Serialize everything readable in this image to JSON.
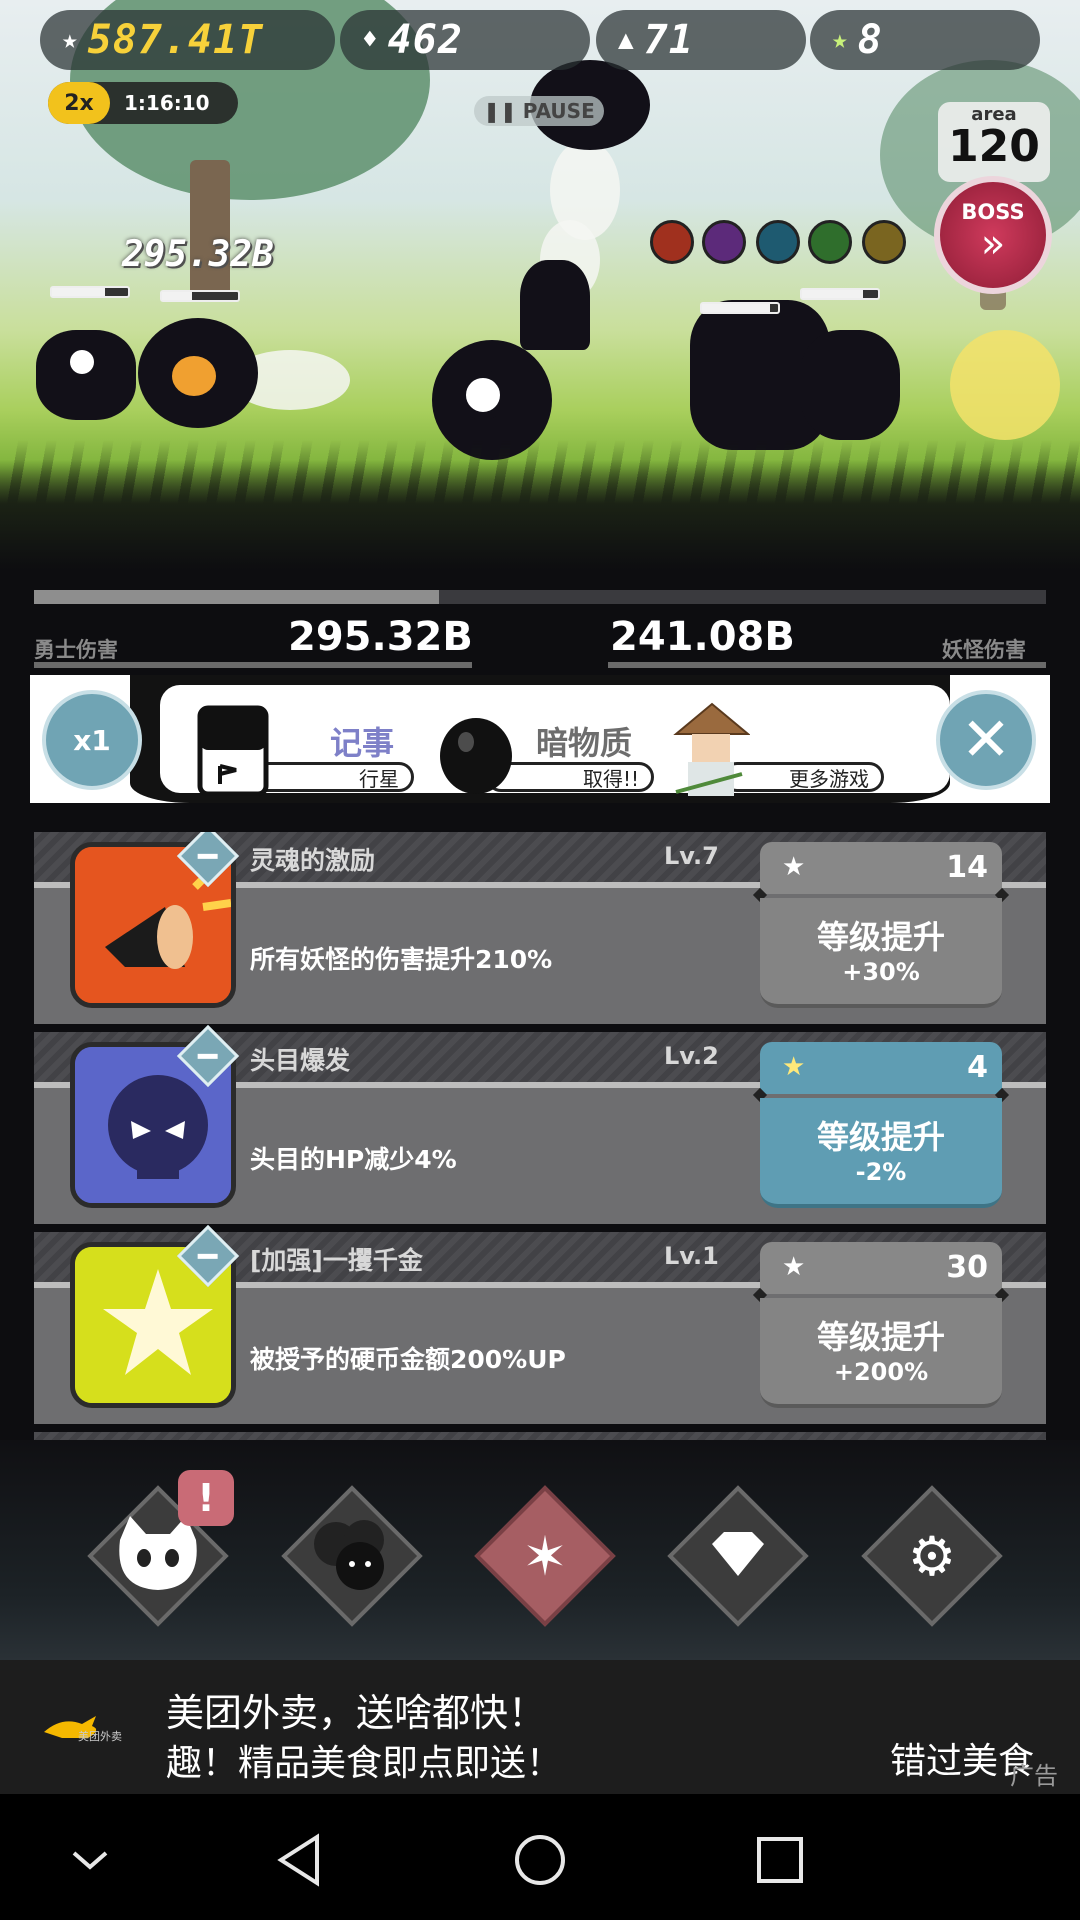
{
  "hud": {
    "gold": "587.41T",
    "gems": "462",
    "souls": "71",
    "rainbow_stars": "8",
    "speed_multiplier": "2x",
    "speed_timer": "1:16:10",
    "pause_label": "PAUSE",
    "area_label": "area",
    "area_number": "120",
    "boss_label": "BOSS",
    "floating_damage": "295.32B"
  },
  "damage_bar": {
    "progress_fraction": 0.4,
    "hero_label": "勇士伤害",
    "hero_value": "295.32B",
    "monster_value": "241.08B",
    "monster_label": "妖怪伤害"
  },
  "banner": {
    "multiplier": "x1",
    "items": [
      {
        "title": "记事",
        "subtitle": "行星"
      },
      {
        "title": "暗物质",
        "subtitle": "取得!!"
      },
      {
        "title": "",
        "subtitle": "更多游戏"
      }
    ]
  },
  "skills": [
    {
      "name": "灵魂的激励",
      "level": "Lv.7",
      "description": "所有妖怪的伤害提升210%",
      "cost": "14",
      "cost_currency": "star-icon",
      "upgrade_label": "等级提升",
      "upgrade_bonus": "+30%",
      "affordable": false,
      "icon": "megaphone-icon",
      "icon_color": "#e5551f"
    },
    {
      "name": "头目爆发",
      "level": "Lv.2",
      "description": "头目的HP减少4%",
      "cost": "4",
      "cost_currency": "rainbow-star-icon",
      "upgrade_label": "等级提升",
      "upgrade_bonus": "-2%",
      "affordable": true,
      "icon": "skull-icon",
      "icon_color": "#5b66c9"
    },
    {
      "name": "[加强]一攫千金",
      "level": "Lv.1",
      "description": "被授予的硬币金额200%UP",
      "cost": "30",
      "cost_currency": "star-icon",
      "upgrade_label": "等级提升",
      "upgrade_bonus": "+200%",
      "affordable": false,
      "icon": "stars-icon",
      "icon_color": "#d6df1c"
    }
  ],
  "nav": {
    "alert_badge": "!",
    "tabs": [
      "ghost-cat-icon",
      "monster-group-icon",
      "star-icon",
      "gem-icon",
      "gear-icon"
    ]
  },
  "ad": {
    "logo_text": "美团外卖",
    "line1": "美团外卖，送啥都快！",
    "line2": "趣！精品美食即点即送！",
    "cta": "错过美食",
    "tag": "广告"
  }
}
